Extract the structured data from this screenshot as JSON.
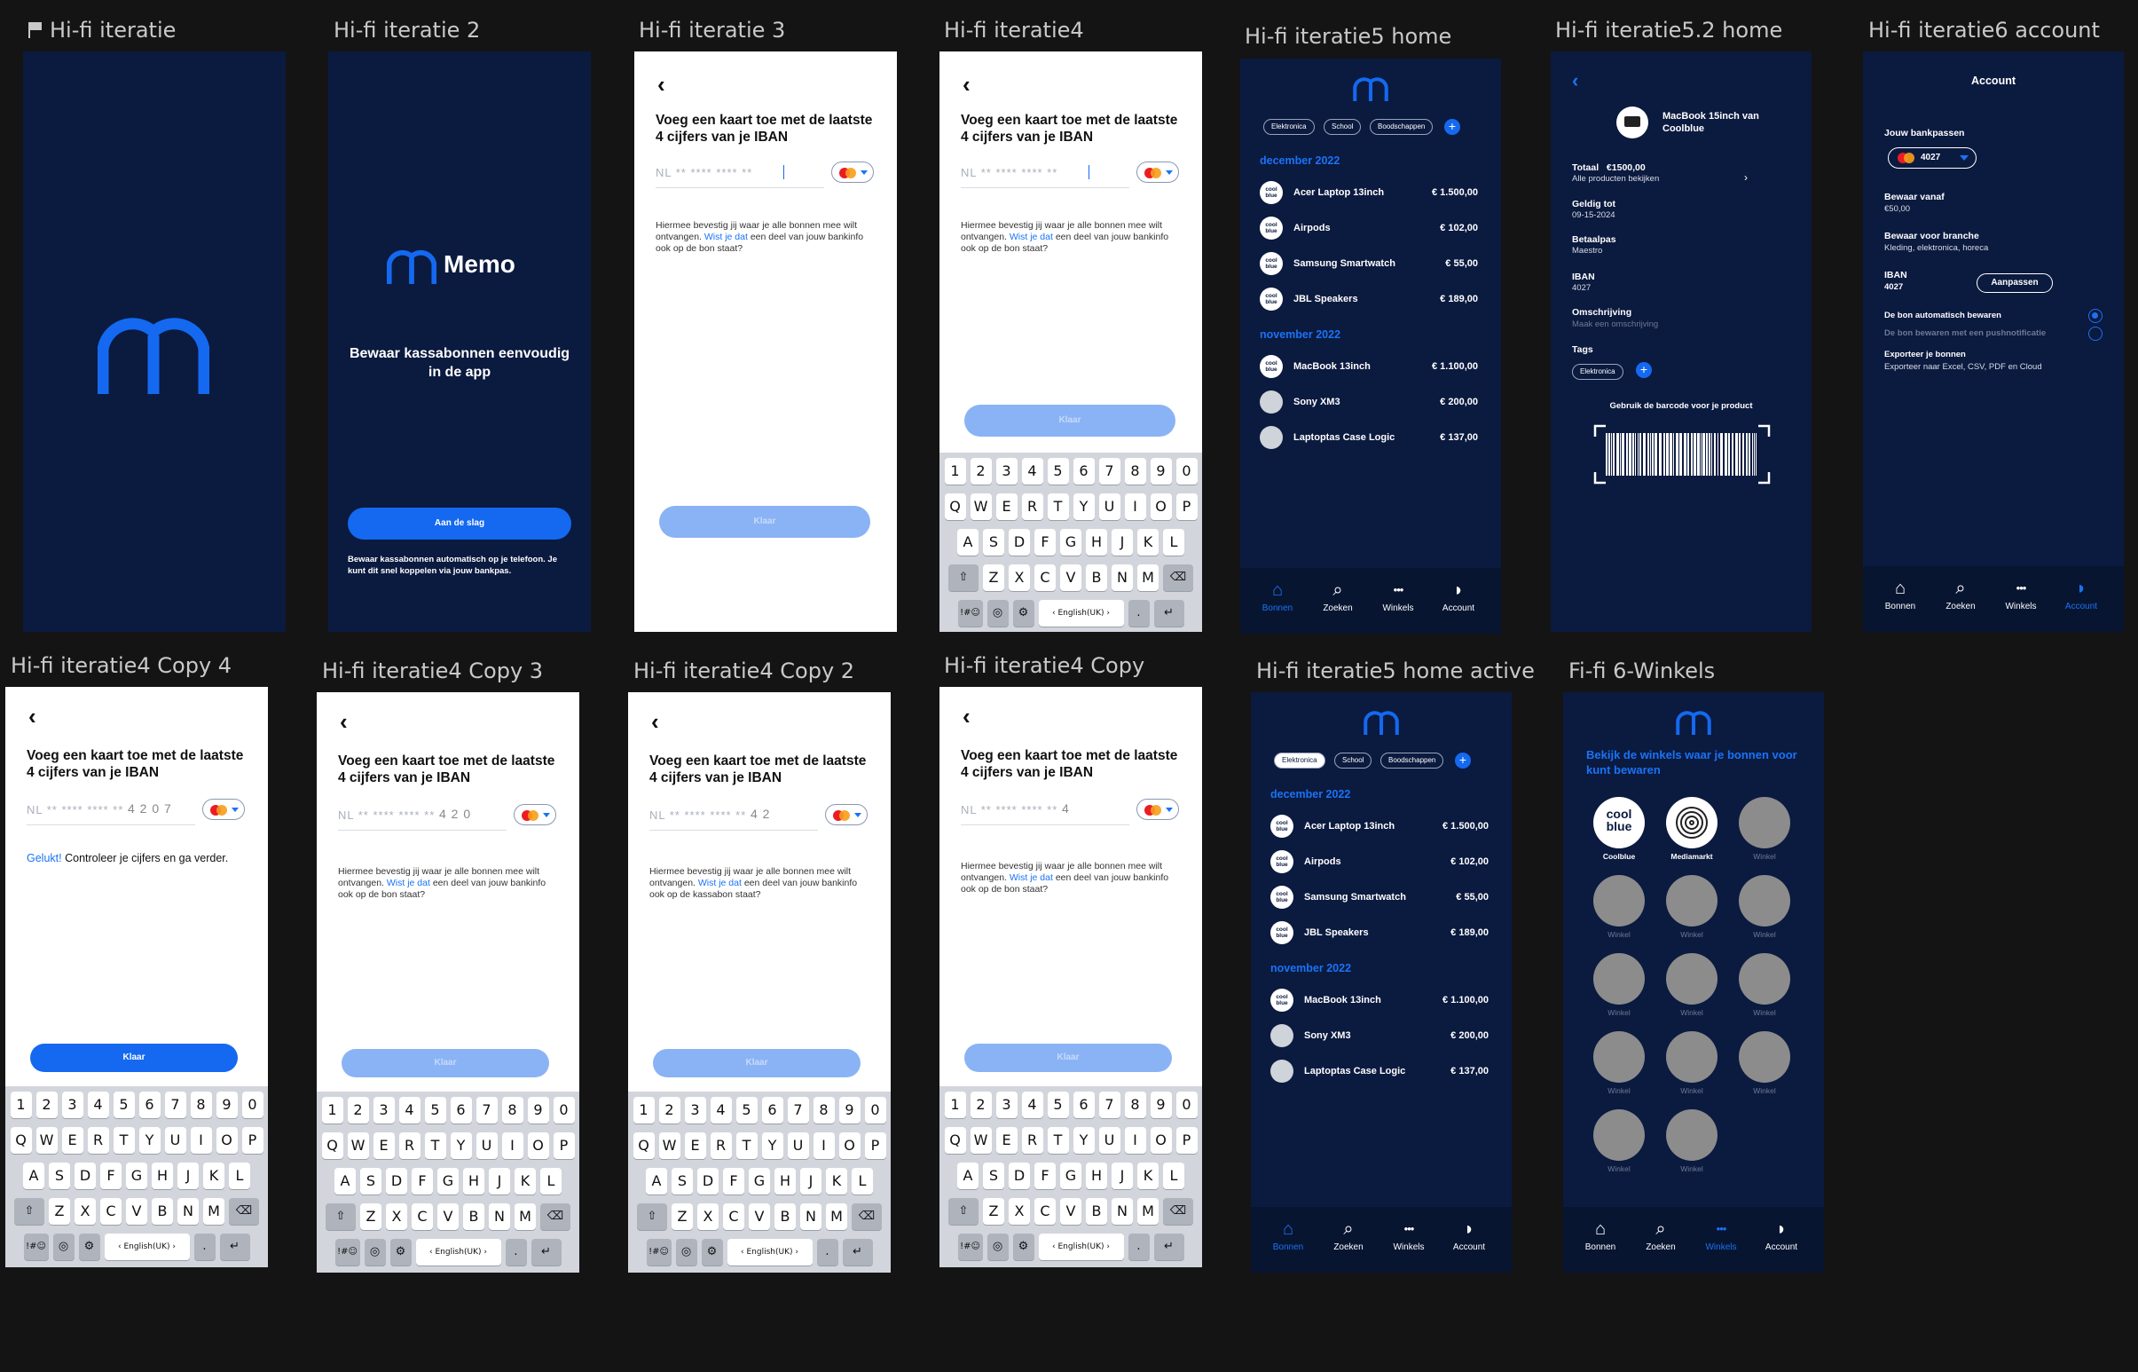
{
  "frames": {
    "f1": "Hi-fi iteratie",
    "f2": "Hi-fi iteratie 2",
    "f3": "Hi-fi iteratie 3",
    "f4": "Hi-fi iteratie4",
    "f5": "Hi-fi iteratie5 home",
    "f6": "Hi-fi iteratie5.2 home",
    "f7": "Hi-fi iteratie6 account",
    "f8": "Hi-fi iteratie4 Copy 4",
    "f9": "Hi-fi iteratie4 Copy 3",
    "f10": "Hi-fi iteratie4 Copy 2",
    "f11": "Hi-fi iteratie4 Copy",
    "f12": "Hi-fi iteratie5 home active",
    "f13": "Fi-fi 6-Winkels"
  },
  "intro": {
    "app_name": "Memo",
    "tagline": "Bewaar kassabonnen eenvoudig in de app",
    "cta": "Aan de slag",
    "note": "Bewaar kassabonnen automatisch op je telefoon. Je kunt dit snel koppelen via jouw bankpas."
  },
  "form": {
    "back": "‹",
    "title": "Voeg een kaart toe met de laatste 4 cijfers van je IBAN",
    "placeholder": "NL ** **** **** **",
    "confirm_pre": "Hiermee bevestig jij waar je alle bonnen mee wilt ontvangen.",
    "confirm_link": "Wist je dat",
    "confirm_post_bank": "een deel van jouw bankinfo ook op de bon staat?",
    "confirm_post_receipt": "een deel van jouw bankinfo ook op de kassabon staat?",
    "done": "Klaar",
    "success_word": "Gelukt!",
    "success_rest": "Controleer je cijfers en ga verder.",
    "digits_copy4": "4 2 0 7",
    "digits_copy3": "4 2 0",
    "digits_copy2": "4 2",
    "digits_copy": "4"
  },
  "keyboard": {
    "row1": [
      "1",
      "2",
      "3",
      "4",
      "5",
      "6",
      "7",
      "8",
      "9",
      "0"
    ],
    "row2": [
      "Q",
      "W",
      "E",
      "R",
      "T",
      "Y",
      "U",
      "I",
      "O",
      "P"
    ],
    "row3": [
      "A",
      "S",
      "D",
      "F",
      "G",
      "H",
      "J",
      "K",
      "L"
    ],
    "row4": [
      "⇧",
      "Z",
      "X",
      "C",
      "V",
      "B",
      "N",
      "M",
      "⌫"
    ],
    "sym": "!#☺",
    "space": "‹ English(UK) ›",
    "dot": ".",
    "enter": "↵"
  },
  "home": {
    "chips": [
      "Elektronica",
      "School",
      "Boodschappen"
    ],
    "plus": "+",
    "months": [
      "december 2022",
      "november 2022"
    ],
    "dec": [
      {
        "name": "Acer Laptop 13inch",
        "price": "€ 1.500,00"
      },
      {
        "name": "Airpods",
        "price": "€ 102,00"
      },
      {
        "name": "Samsung Smartwatch",
        "price": "€ 55,00"
      },
      {
        "name": "JBL Speakers",
        "price": "€ 189,00"
      }
    ],
    "nov": [
      {
        "name": "MacBook 13inch",
        "price": "€ 1.100,00"
      },
      {
        "name": "Sony XM3",
        "price": "€ 200,00"
      },
      {
        "name": "Laptoptas Case Logic",
        "price": "€ 137,00"
      }
    ],
    "avatar_text": "cool blue"
  },
  "nav": [
    "Bonnen",
    "Zoeken",
    "Winkels",
    "Account"
  ],
  "detail": {
    "back": "‹",
    "title": "MacBook 15inch van Coolblue",
    "totaal_label": "Totaal",
    "totaal_value": "€1500,00",
    "all_products": "Alle producten bekijken",
    "geldig_label": "Geldig tot",
    "geldig_value": "09-15-2024",
    "betaalpas_label": "Betaalpas",
    "betaalpas_value": "Maestro",
    "iban_label": "IBAN",
    "iban_value": "4027",
    "omschrijving_label": "Omschrijving",
    "omschrijving_ph": "Maak een omschrijving",
    "tags_label": "Tags",
    "tag": "Elektronica",
    "barcode_hint": "Gebruik de barcode voor je product"
  },
  "account": {
    "title": "Account",
    "passes_label": "Jouw bankpassen",
    "pass": "4027",
    "bewaar_vanaf_label": "Bewaar vanaf",
    "bewaar_vanaf_value": "€50,00",
    "branche_label": "Bewaar voor branche",
    "branche_value": "Kleding, elektronica, horeca",
    "iban_label": "IBAN",
    "iban_value": "4027",
    "aanpassen": "Aanpassen",
    "opt_auto": "De bon automatisch bewaren",
    "opt_push": "De bon bewaren met een pushnotificatie",
    "export_label": "Exporteer je bonnen",
    "export_value": "Exporteer naar Excel, CSV, PDF en Cloud"
  },
  "shops": {
    "heading": "Bekijk de winkels waar je bonnen voor kunt bewaren",
    "names": [
      "Coolblue",
      "Mediamarkt",
      "Winkel",
      "Winkel",
      "Winkel",
      "Winkel",
      "Winkel",
      "Winkel",
      "Winkel",
      "Winkel",
      "Winkel",
      "Winkel",
      "Winkel",
      "Winkel"
    ],
    "coolblue_logo": "cool blue"
  },
  "colors": {
    "accent": "#1469f0",
    "dark_bg": "#0b1a3f",
    "canvas": "#141414"
  }
}
